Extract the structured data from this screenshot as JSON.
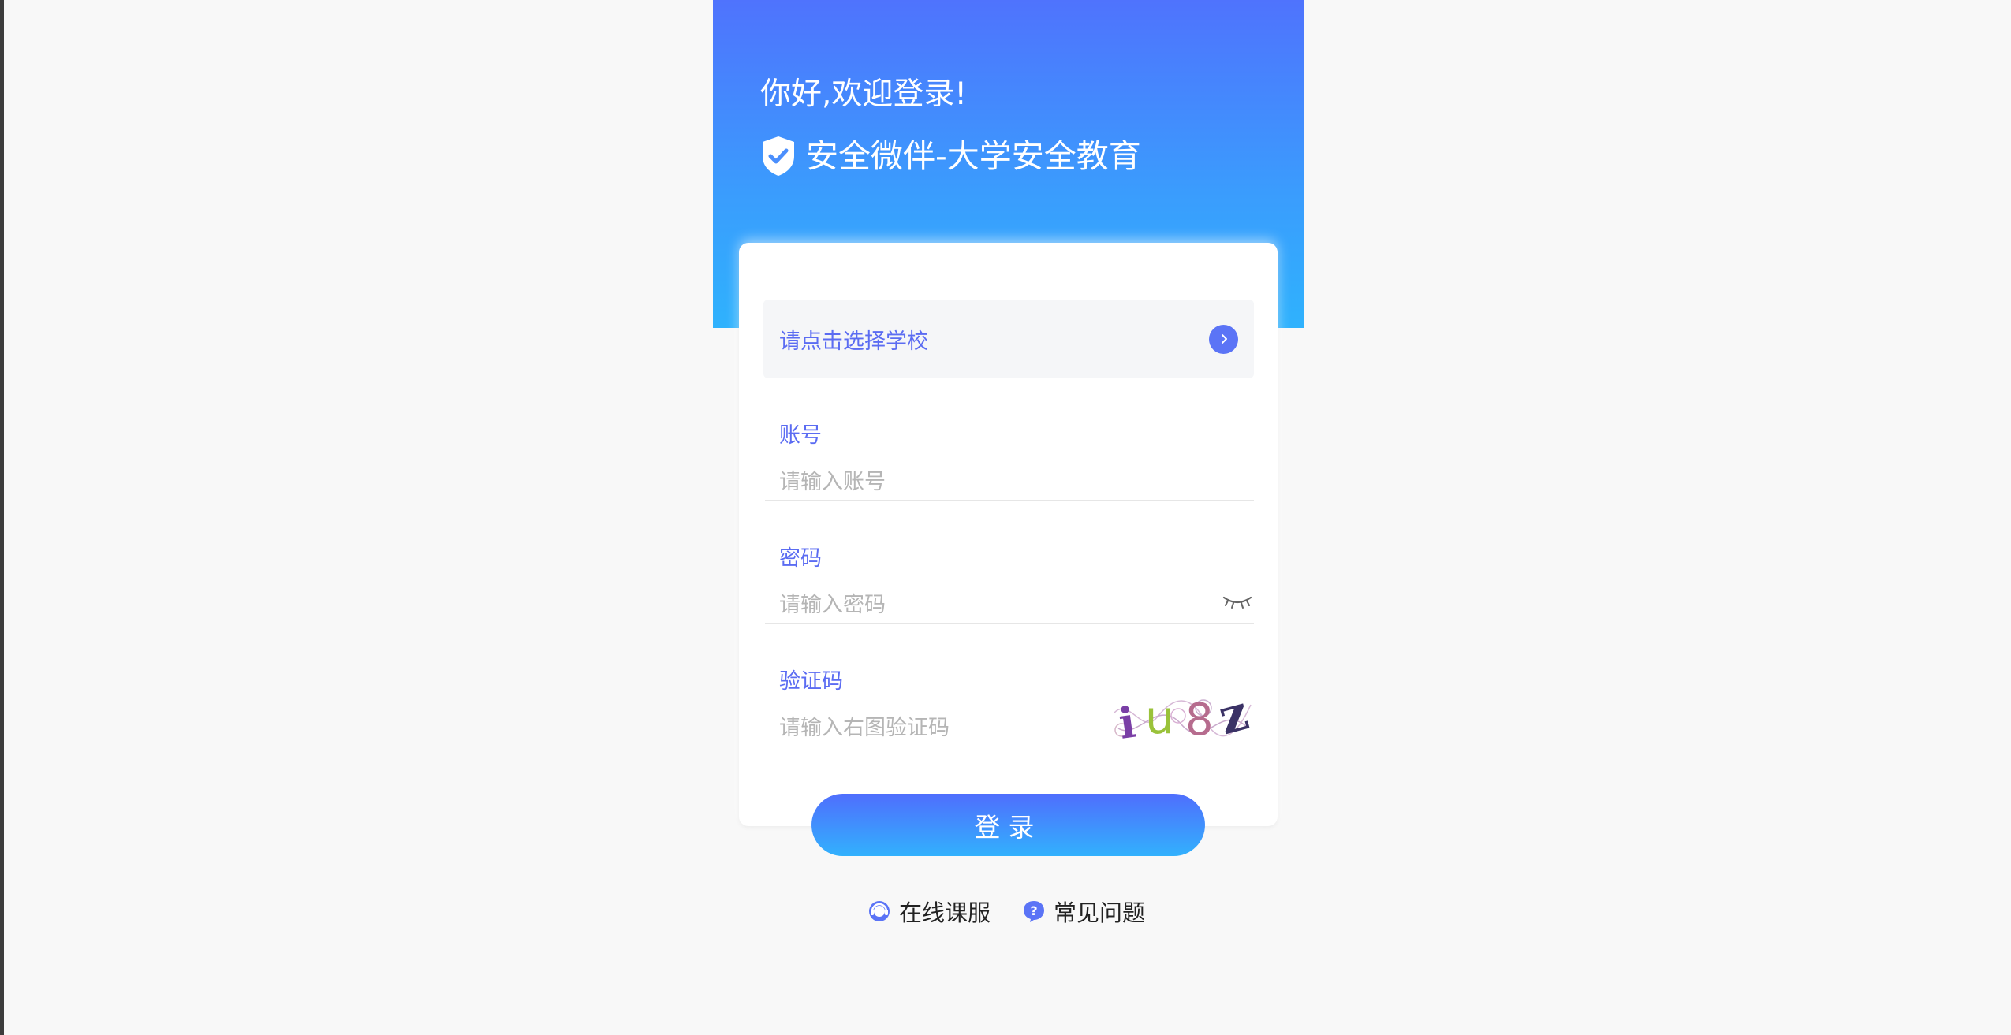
{
  "header": {
    "greeting": "你好,欢迎登录!",
    "brand_title": "安全微伴-大学安全教育",
    "brand_icon": "shield-check-icon"
  },
  "school": {
    "placeholder": "请点击选择学校",
    "icon": "chevron-right-icon"
  },
  "account": {
    "label": "账号",
    "placeholder": "请输入账号",
    "value": ""
  },
  "password": {
    "label": "密码",
    "placeholder": "请输入密码",
    "value": "",
    "toggle_icon": "eye-closed-icon"
  },
  "captcha": {
    "label": "验证码",
    "placeholder": "请输入右图验证码",
    "value": "",
    "image_text": "iu8z"
  },
  "login_button": {
    "label": "登录"
  },
  "footer": {
    "support_label": "在线课服",
    "support_icon": "headset-icon",
    "faq_label": "常见问题",
    "faq_icon": "question-bubble-icon"
  },
  "colors": {
    "header_gradient_top": "#4f73fd",
    "header_gradient_bottom": "#2fb2fd",
    "accent": "#5b6cf2",
    "background": "#f8f8f8",
    "placeholder": "#b5b5b5"
  }
}
